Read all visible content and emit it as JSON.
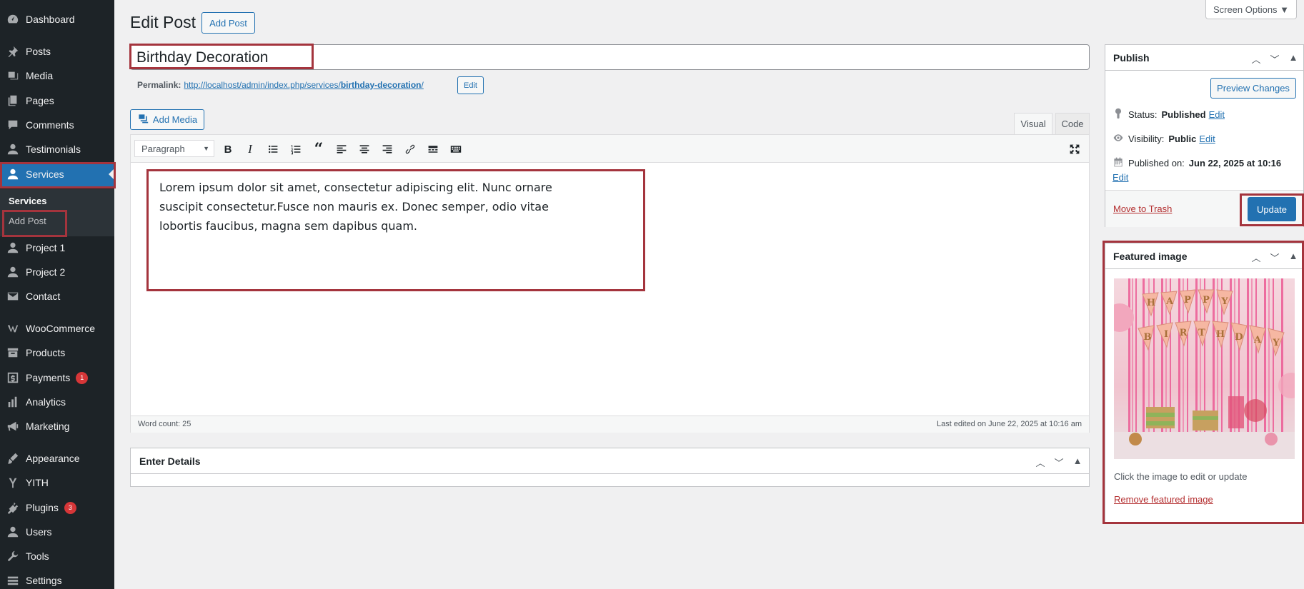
{
  "sidebar": {
    "items": [
      {
        "label": "Dashboard",
        "icon": "dashboard-icon"
      },
      {
        "label": "Posts",
        "icon": "pushpin-icon"
      },
      {
        "label": "Media",
        "icon": "media-icon"
      },
      {
        "label": "Pages",
        "icon": "pages-icon"
      },
      {
        "label": "Comments",
        "icon": "comments-icon"
      },
      {
        "label": "Testimonials",
        "icon": "user-icon"
      },
      {
        "label": "Services",
        "icon": "user-icon"
      },
      {
        "label": "Project 1",
        "icon": "user-icon"
      },
      {
        "label": "Project 2",
        "icon": "user-icon"
      },
      {
        "label": "Contact",
        "icon": "mail-icon"
      },
      {
        "label": "WooCommerce",
        "icon": "woocommerce-icon"
      },
      {
        "label": "Products",
        "icon": "archive-icon"
      },
      {
        "label": "Payments",
        "icon": "dollar-icon",
        "badge": "1"
      },
      {
        "label": "Analytics",
        "icon": "chart-icon"
      },
      {
        "label": "Marketing",
        "icon": "megaphone-icon"
      },
      {
        "label": "Appearance",
        "icon": "brush-icon"
      },
      {
        "label": "YITH",
        "icon": "yith-icon"
      },
      {
        "label": "Plugins",
        "icon": "plugin-icon",
        "badge": "3"
      },
      {
        "label": "Users",
        "icon": "user-icon"
      },
      {
        "label": "Tools",
        "icon": "wrench-icon"
      },
      {
        "label": "Settings",
        "icon": "settings-icon"
      }
    ],
    "submenu": {
      "title": "Services",
      "add_post": "Add Post"
    }
  },
  "header": {
    "title": "Edit Post",
    "add_post_button": "Add Post",
    "screen_options": "Screen Options ▼"
  },
  "post": {
    "title": "Birthday Decoration",
    "permalink_label": "Permalink:",
    "permalink_base": "http://localhost/admin/index.php/services/",
    "permalink_slug": "birthday-decoration",
    "permalink_trail": "/",
    "permalink_edit": "Edit"
  },
  "editor": {
    "add_media": "Add Media",
    "tab_visual": "Visual",
    "tab_code": "Code",
    "format_select": "Paragraph",
    "content_line1": "Lorem ipsum dolor sit amet, consectetur adipiscing elit. Nunc ornare",
    "content_line2": "suscipit consectetur.Fusce non mauris ex. Donec semper, odio vitae",
    "content_line3": "lobortis faucibus, magna sem dapibus quam.",
    "word_count": "Word count: 25",
    "last_edited": "Last edited on June 22, 2025 at 10:16 am"
  },
  "details_box": {
    "title": "Enter Details"
  },
  "publish": {
    "title": "Publish",
    "preview_button": "Preview Changes",
    "status_label": "Status:",
    "status_value": "Published",
    "visibility_label": "Visibility:",
    "visibility_value": "Public",
    "published_label": "Published on:",
    "published_value": "Jun 22, 2025 at 10:16",
    "edit": "Edit",
    "trash": "Move to Trash",
    "update": "Update"
  },
  "featured": {
    "title": "Featured image",
    "banner_letters_top": "HAPPY",
    "banner_letters_bottom": "BIRTHDAY",
    "hint": "Click the image to edit or update",
    "remove": "Remove featured image"
  },
  "colors": {
    "accent": "#2271b1",
    "highlight": "#a4343d",
    "sidebar": "#1d2327"
  }
}
